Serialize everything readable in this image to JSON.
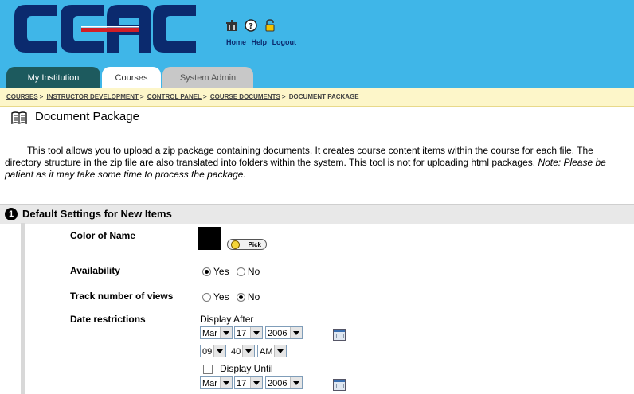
{
  "header": {
    "logo_text": "CCAC",
    "links": [
      {
        "label": "Home",
        "icon": "home-icon"
      },
      {
        "label": "Help",
        "icon": "help-icon"
      },
      {
        "label": "Logout",
        "icon": "logout-icon"
      }
    ]
  },
  "tabs": [
    {
      "label": "My Institution",
      "state": "inactive"
    },
    {
      "label": "Courses",
      "state": "active"
    },
    {
      "label": "System Admin",
      "state": "inactive"
    }
  ],
  "breadcrumb": {
    "items": [
      "COURSES",
      "INSTRUCTOR DEVELOPMENT",
      "CONTROL PANEL",
      "COURSE DOCUMENTS"
    ],
    "current": "DOCUMENT PACKAGE",
    "separator": ">"
  },
  "page": {
    "title": "Document Package",
    "description": "This tool allows you to upload a zip package containing documents. It creates course content items within the course for each file. The directory structure in the zip file are also translated into folders within the system. This tool is not for uploading html packages.",
    "note": "Note: Please be patient as it may take some time to process the package."
  },
  "section1": {
    "number": "1",
    "title": "Default Settings for New Items",
    "color_label": "Color of Name",
    "color_value": "#000000",
    "pick_label": "Pick",
    "availability": {
      "label": "Availability",
      "options": [
        "Yes",
        "No"
      ],
      "selected": "Yes"
    },
    "track": {
      "label": "Track number of views",
      "options": [
        "Yes",
        "No"
      ],
      "selected": "No"
    },
    "dates": {
      "label": "Date restrictions",
      "after_label": "Display After",
      "after_month": "Mar",
      "after_day": "17",
      "after_year": "2006",
      "after_hour": "09",
      "after_minute": "40",
      "after_ampm": "AM",
      "until_label": "Display Until",
      "until_checked": false,
      "until_month": "Mar",
      "until_day": "17",
      "until_year": "2006"
    }
  },
  "colors": {
    "header_bg": "#3fb6e8",
    "logo_blue": "#0b2a6e",
    "logo_red": "#d21f26",
    "tab_active_bg": "#ffffff",
    "tab_dark_bg": "#1d5a5e",
    "breadcrumb_bg": "#fdf6c9",
    "section_bg": "#e8e8e8"
  }
}
